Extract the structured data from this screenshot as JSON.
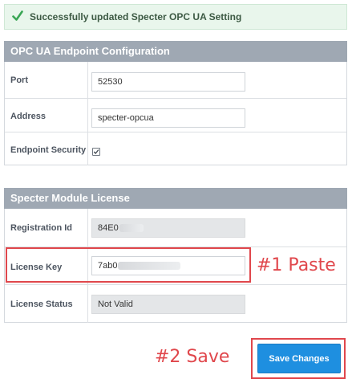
{
  "alert": {
    "message": "Successfully updated Specter OPC UA Setting",
    "icon": "check-icon",
    "color": "#3aa655"
  },
  "endpoint_config": {
    "title": "OPC UA Endpoint Configuration",
    "port_label": "Port",
    "port_value": "52530",
    "address_label": "Address",
    "address_value": "specter-opcua",
    "security_label": "Endpoint Security",
    "security_checked": true
  },
  "license": {
    "title": "Specter Module License",
    "registration_label": "Registration Id",
    "registration_value": "84E0",
    "license_key_label": "License Key",
    "license_key_value": "7ab0",
    "status_label": "License Status",
    "status_value": "Not Valid"
  },
  "annotations": {
    "paste": "#1 Paste",
    "save": "#2 Save",
    "color": "#e0474c"
  },
  "save_button": {
    "label": "Save Changes",
    "color": "#1e8fe0"
  }
}
